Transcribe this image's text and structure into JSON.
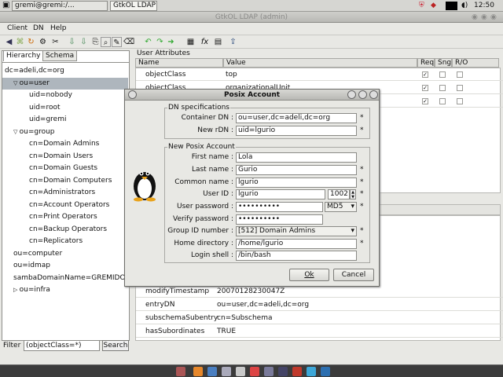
{
  "taskbar": {
    "tasks": [
      "gremi@gremi:/...",
      "GtkOL LDAP [a..."
    ],
    "clock": "12:50"
  },
  "window": {
    "title": "GtkOL LDAP (admin)"
  },
  "menu": [
    "Client",
    "DN",
    "Help"
  ],
  "left": {
    "tabs": [
      "Hierarchy",
      "Schema"
    ],
    "tree": [
      {
        "text": "dc=adeli,dc=org",
        "level": 0,
        "expander": ""
      },
      {
        "text": "ou=user",
        "level": 1,
        "expander": "▽",
        "selected": true
      },
      {
        "text": "uid=nobody",
        "level": 2,
        "expander": ""
      },
      {
        "text": "uid=root",
        "level": 2,
        "expander": ""
      },
      {
        "text": "uid=gremi",
        "level": 2,
        "expander": ""
      },
      {
        "text": "ou=group",
        "level": 1,
        "expander": "▽"
      },
      {
        "text": "cn=Domain Admins",
        "level": 2,
        "expander": ""
      },
      {
        "text": "cn=Domain Users",
        "level": 2,
        "expander": ""
      },
      {
        "text": "cn=Domain Guests",
        "level": 2,
        "expander": ""
      },
      {
        "text": "cn=Domain Computers",
        "level": 2,
        "expander": ""
      },
      {
        "text": "cn=Administrators",
        "level": 2,
        "expander": ""
      },
      {
        "text": "cn=Account Operators",
        "level": 2,
        "expander": ""
      },
      {
        "text": "cn=Print Operators",
        "level": 2,
        "expander": ""
      },
      {
        "text": "cn=Backup Operators",
        "level": 2,
        "expander": ""
      },
      {
        "text": "cn=Replicators",
        "level": 2,
        "expander": ""
      },
      {
        "text": "ou=computer",
        "level": 1,
        "expander": ""
      },
      {
        "text": "ou=idmap",
        "level": 1,
        "expander": ""
      },
      {
        "text": "sambaDomainName=GREMIDOM",
        "level": 1,
        "expander": ""
      },
      {
        "text": "ou=infra",
        "level": 1,
        "expander": "▷"
      }
    ],
    "filter_label": "Filter :",
    "filter_value": "(objectClass=*)",
    "search_button": "Search"
  },
  "attributes": {
    "group_label": "User Attributes",
    "columns": [
      "Name",
      "Value",
      "Req",
      "Sng",
      "R/O"
    ],
    "top_rows": [
      {
        "name": "objectClass",
        "value": "top",
        "req": true,
        "sng": false,
        "ro": false
      },
      {
        "name": "objectClass",
        "value": "organizationalUnit",
        "req": true,
        "sng": false,
        "ro": false
      },
      {
        "name": "",
        "value": "",
        "req": true,
        "sng": false,
        "ro": false
      }
    ],
    "bottom_rows": [
      {
        "name": "modifyTimestamp",
        "value": "20070128230047Z"
      },
      {
        "name": "entryDN",
        "value": "ou=user,dc=adeli,dc=org"
      },
      {
        "name": "subschemaSubentry",
        "value": "cn=Subschema"
      },
      {
        "name": "hasSubordinates",
        "value": "TRUE"
      }
    ]
  },
  "dialog": {
    "title": "Posix Account",
    "dn_group": "DN specifications",
    "container_dn_label": "Container DN :",
    "container_dn": "ou=user,dc=adeli,dc=org",
    "new_rdn_label": "New rDN :",
    "new_rdn": "uid=lgurio",
    "account_group": "New Posix Account",
    "first_name_label": "First name :",
    "first_name": "Lola",
    "last_name_label": "Last name :",
    "last_name": "Gurio",
    "common_name_label": "Common name :",
    "common_name": "lgurio",
    "user_id_label": "User ID :",
    "user_id": "lgurio",
    "uid_number": "1002",
    "password_label": "User password :",
    "password": "••••••••••",
    "hash": "MD5",
    "verify_label": "Verify password :",
    "verify": "••••••••••",
    "gid_label": "Group ID number :",
    "gid": "[512] Domain Admins",
    "home_label": "Home directory :",
    "home": "/home/lgurio",
    "shell_label": "Login shell :",
    "shell": "/bin/bash",
    "required_mark": "*",
    "ok": "Ok",
    "cancel": "Cancel"
  }
}
